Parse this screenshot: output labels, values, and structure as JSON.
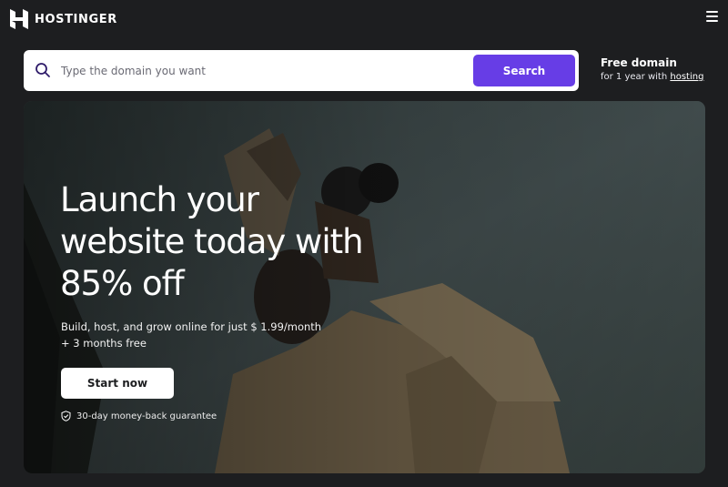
{
  "header": {
    "brand": "HOSTINGER",
    "logo_icon": "hostinger-logo-icon",
    "menu_icon": "hamburger-menu-icon"
  },
  "search": {
    "placeholder": "Type the domain you want",
    "value": "",
    "button_label": "Search",
    "icon": "search-icon"
  },
  "promo": {
    "title": "Free domain",
    "subtitle_prefix": "for 1 year with ",
    "link_label": "hosting"
  },
  "hero": {
    "title_lines": [
      "Launch your",
      "website today with",
      "85% off"
    ],
    "subtitle": "Build, host, and grow online for just $ 1.99/month + 3 months free",
    "cta_label": "Start now",
    "guarantee": "30-day money-back guarantee",
    "guarantee_icon": "shield-check-icon"
  },
  "colors": {
    "page_background": "#1d1e20",
    "accent": "#673de6",
    "text": "#ffffff"
  }
}
